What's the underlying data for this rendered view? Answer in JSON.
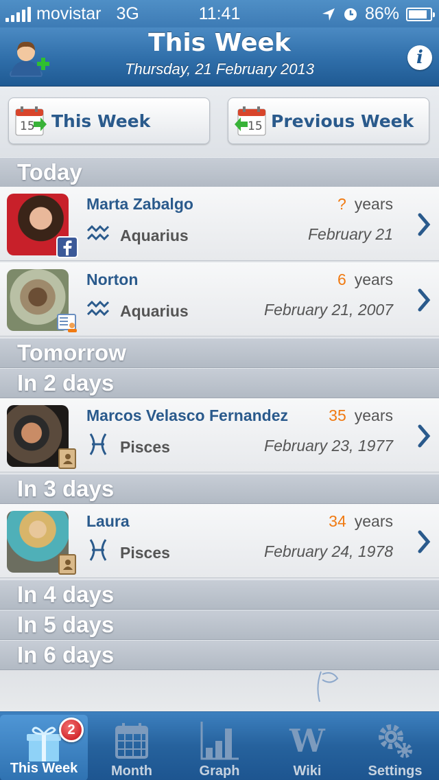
{
  "status_bar": {
    "carrier": "movistar",
    "network": "3G",
    "time": "11:41",
    "battery": "86%",
    "battery_level": 0.86
  },
  "header": {
    "title": "This Week",
    "date": "Thursday, 21 February 2013",
    "add_icon": "add-contact-icon",
    "info_icon": "info-icon"
  },
  "week_buttons": {
    "this_week": "This Week",
    "previous_week": "Previous Week",
    "calendar_day": "15"
  },
  "sections": {
    "today": "Today",
    "tomorrow": "Tomorrow",
    "in_2_days": "In 2 days",
    "in_3_days": "In 3 days",
    "in_4_days": "In 4 days",
    "in_5_days": "In 5 days",
    "in_6_days": "In 6 days"
  },
  "contacts": [
    {
      "name": "Marta Zabalgo",
      "age": "?",
      "age_unit": "years",
      "sign": "Aquarius",
      "date": "February 21",
      "source": "facebook-icon"
    },
    {
      "name": "Norton",
      "age": "6",
      "age_unit": "years",
      "sign": "Aquarius",
      "date": "February 21, 2007",
      "source": "contact-card-icon"
    },
    {
      "name": "Marcos Velasco Fernandez",
      "age": "35",
      "age_unit": "years",
      "sign": "Pisces",
      "date": "February 23, 1977",
      "source": "address-book-icon"
    },
    {
      "name": "Laura",
      "age": "34",
      "age_unit": "years",
      "sign": "Pisces",
      "date": "February 24, 1978",
      "source": "address-book-icon"
    }
  ],
  "tab_bar": {
    "items": [
      {
        "label": "This Week",
        "icon": "gift-icon",
        "badge": "2",
        "active": true
      },
      {
        "label": "Month",
        "icon": "calendar-icon"
      },
      {
        "label": "Graph",
        "icon": "bar-graph-icon"
      },
      {
        "label": "Wiki",
        "icon": "wikipedia-icon"
      },
      {
        "label": "Settings",
        "icon": "gears-icon"
      }
    ]
  },
  "colors": {
    "header_blue": "#2f6ea9",
    "name_blue": "#2a5a8c",
    "age_orange": "#f07a12",
    "badge_red": "#c60e14"
  }
}
